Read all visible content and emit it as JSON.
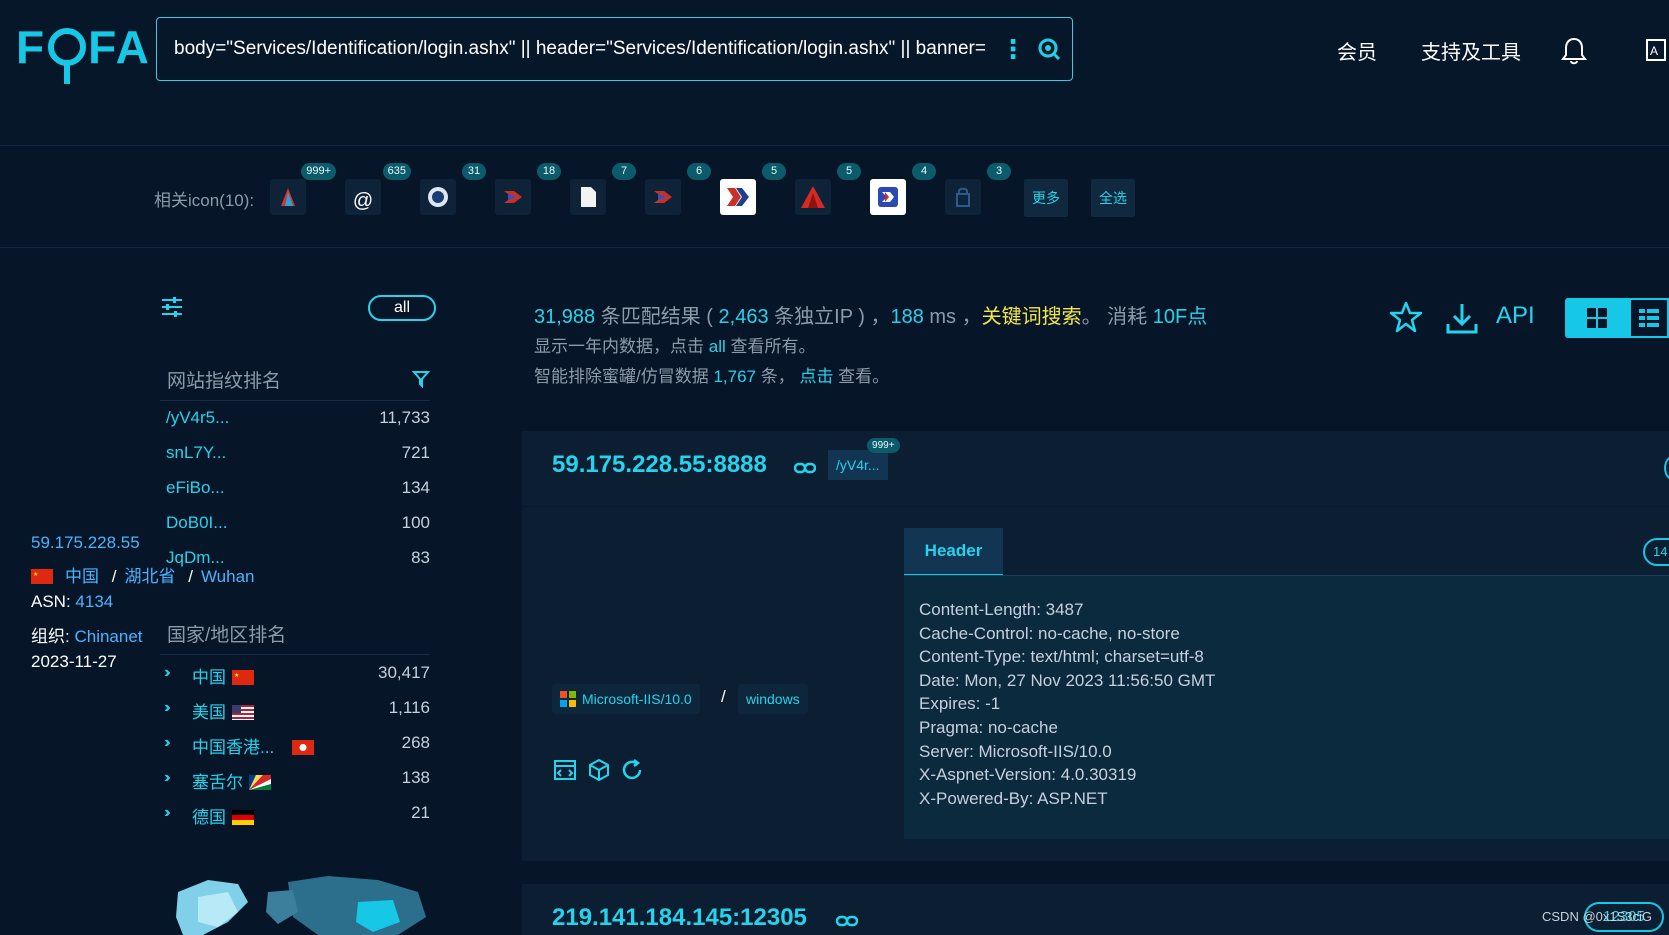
{
  "header": {
    "logo_text_left": "F",
    "logo_text_right": "FA",
    "search_query": "body=\"Services/Identification/login.ashx\" || header=\"Services/Identification/login.ashx\" || banner=",
    "nav_vip": "会员",
    "nav_tools": "支持及工具"
  },
  "icon_strip": {
    "label": "相关icon(10):",
    "icons": [
      {
        "name": "favicon-1",
        "count": "999+"
      },
      {
        "name": "favicon-2",
        "count": "635"
      },
      {
        "name": "favicon-3",
        "count": "31"
      },
      {
        "name": "favicon-4",
        "count": "18"
      },
      {
        "name": "favicon-5",
        "count": "7"
      },
      {
        "name": "favicon-6",
        "count": "6"
      },
      {
        "name": "favicon-7",
        "count": "5"
      },
      {
        "name": "favicon-8",
        "count": "5"
      },
      {
        "name": "favicon-9",
        "count": "4"
      },
      {
        "name": "favicon-10",
        "count": "3"
      }
    ],
    "more_label": "更多",
    "select_all_label": "全选"
  },
  "sidebar": {
    "all_label": "all",
    "fingerprint_title": "网站指纹排名",
    "fingerprints": [
      {
        "name": "/yV4r5...",
        "count": "11,733"
      },
      {
        "name": "snL7Y...",
        "count": "721"
      },
      {
        "name": "eFiBo...",
        "count": "134"
      },
      {
        "name": "DoB0I...",
        "count": "100"
      },
      {
        "name": "JqDm...",
        "count": "83"
      }
    ],
    "country_title": "国家/地区排名",
    "countries": [
      {
        "name": "中国",
        "count": "30,417",
        "flag": "cn"
      },
      {
        "name": "美国",
        "count": "1,116",
        "flag": "us"
      },
      {
        "name": "中国香港...",
        "count": "268",
        "flag": "hk"
      },
      {
        "name": "塞舌尔",
        "count": "138",
        "flag": "sc"
      },
      {
        "name": "德国",
        "count": "21",
        "flag": "de"
      }
    ]
  },
  "stats": {
    "total": "31,988",
    "total_suffix": " 条匹配结果 ( ",
    "ips": "2,463",
    "ips_suffix": " 条独立IP ) ，",
    "time_ms": "188",
    "time_suffix": " ms ，",
    "keyword_search": "关键词搜索",
    "cost_prefix": "。 消耗 ",
    "cost": "10F点",
    "line2_prefix": "显示一年内数据，点击 ",
    "line2_link": "all",
    "line2_suffix": " 查看所有。",
    "line3_prefix": "智能排除蜜罐/仿冒数据 ",
    "line3_count": "1,767",
    "line3_mid": " 条， ",
    "line3_link": "点击",
    "line3_suffix": " 查看。",
    "api_label": "API"
  },
  "result1": {
    "host": "59.175.228.55:8888",
    "fp_tag": "/yV4r...",
    "fp_count": "999+",
    "ip": "59.175.228.55",
    "country": "中国",
    "province": "湖北省",
    "city": "Wuhan",
    "sep": "/",
    "asn_label": "ASN:",
    "asn": "4134",
    "org_label": "组织:",
    "org": "Chinanet",
    "date": "2023-11-27",
    "server_chip": "Microsoft-IIS/10.0",
    "chip_sep": "/",
    "os_chip": "windows",
    "tab_header": "Header",
    "tab_pill": "14",
    "header_lines": [
      "Content-Length: 3487",
      "Cache-Control: no-cache, no-store",
      "Content-Type: text/html; charset=utf-8",
      "Date: Mon, 27 Nov 2023 11:56:50 GMT",
      "Expires: -1",
      "Pragma: no-cache",
      "Server: Microsoft-IIS/10.0",
      "X-Aspnet-Version: 4.0.30319",
      "X-Powered-By: ASP.NET"
    ]
  },
  "result2": {
    "host": "219.141.184.145:12305",
    "port_pill": "12305"
  },
  "watermark": "CSDN @0x1S3ciG",
  "colors": {
    "accent": "#26d3ec",
    "background": "#061528",
    "highlight": "#f2e64b"
  }
}
